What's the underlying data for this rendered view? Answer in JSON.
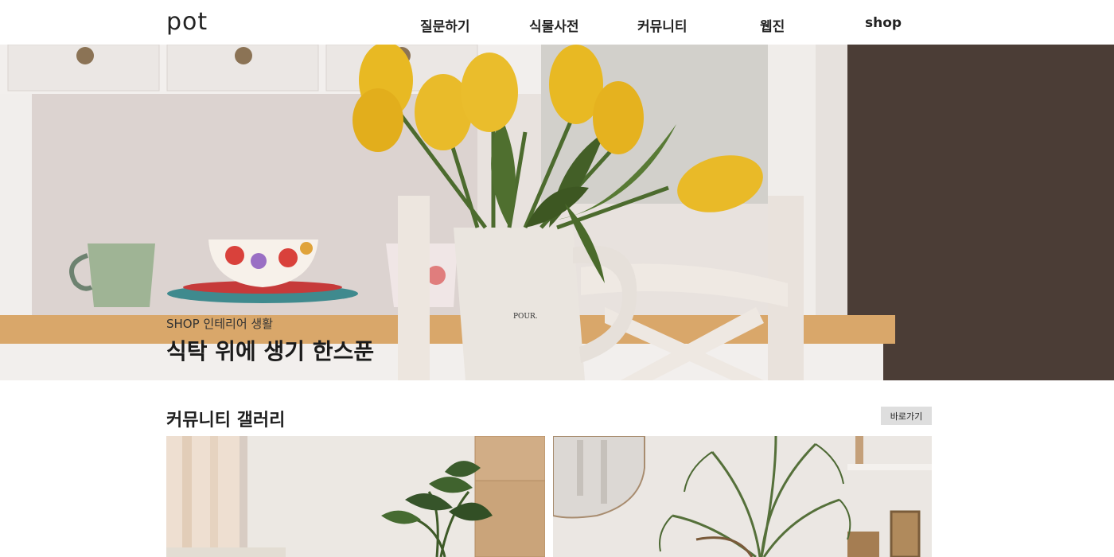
{
  "brand": {
    "logo_text": "pot"
  },
  "nav": {
    "items": [
      {
        "label": "질문하기"
      },
      {
        "label": "식물사전"
      },
      {
        "label": "커뮤니티"
      },
      {
        "label": "웹진"
      },
      {
        "label": "shop"
      }
    ]
  },
  "hero": {
    "subtitle": "SHOP 인테리어 생활",
    "title": "식탁 위에 생기 한스푼",
    "image_subject": "yellow tulips in white pitcher on dining table",
    "pitcher_text": "POUR."
  },
  "gallery": {
    "title": "커뮤니티 갤러리",
    "button_label": "바로가기",
    "cards": [
      {
        "image_subject": "room with tropical plant and wooden cabinet"
      },
      {
        "image_subject": "palm plant near round mirror and shelf"
      }
    ]
  },
  "colors": {
    "tulip": "#e8b923",
    "leaf": "#4c6b2e",
    "wall_dark": "#4a3c35",
    "button_bg": "#dedede"
  }
}
